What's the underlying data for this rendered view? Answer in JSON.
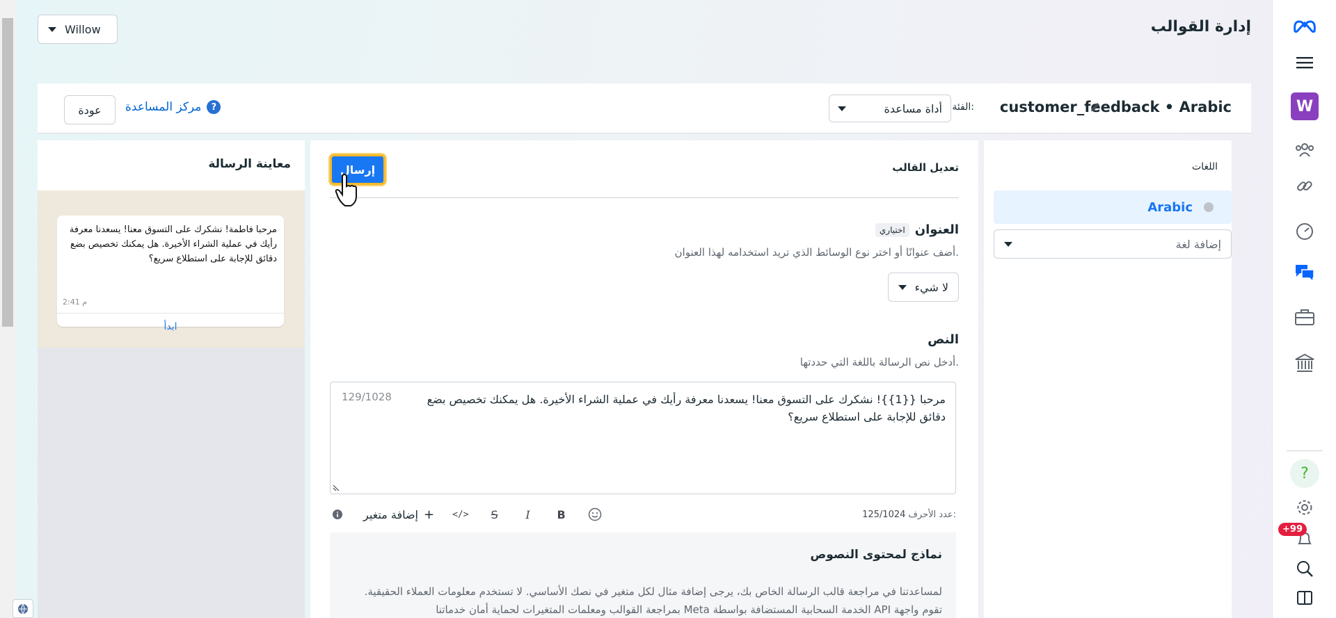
{
  "page_title": "إدارة القوالب",
  "account": {
    "name": "Willow"
  },
  "rail": {
    "workspace_initial": "W",
    "notifications_badge": "+99"
  },
  "header": {
    "template_name": "customer_feedback • Arabic",
    "category_label": "الفئة:",
    "category_value": "أداة مساعدة",
    "help_center": "مركز المساعدة",
    "back": "عودة"
  },
  "languages": {
    "title": "اللغات",
    "items": [
      {
        "label": "Arabic"
      }
    ],
    "add_placeholder": "إضافة لغة"
  },
  "editor": {
    "title": "تعديل القالب",
    "send": "إرسال",
    "header_section": {
      "title": "العنوان",
      "optional": "اختياري",
      "desc": "أضف عنوانًا أو اختر نوع الوسائط الذي تريد استخدامه لهذا العنوان.",
      "media_value": "لا شيء"
    },
    "body_section": {
      "title": "النص",
      "desc": "أدخل نص الرسالة باللغة التي حددتها.",
      "text": "مرحبا {{1}}! نشكرك على التسوق معنا! يسعدنا معرفة رأيك في عملية الشراء الأخيرة. هل يمكنك تخصيص بضع دقائق للإجابة على استطلاع سريع؟",
      "counter": "129/1028"
    },
    "toolbar": {
      "add_variable": "إضافة متغير",
      "char_label": "عدد الأحرف:",
      "char_count": "125/1024"
    },
    "samples": {
      "title": "نماذج لمحتوى النصوص",
      "desc": "لمساعدتنا في مراجعة قالب الرسالة الخاص بك، يرجى إضافة مثال لكل متغير في نصك الأساسي. لا تستخدم معلومات العملاء الحقيقية. تقوم واجهة API الخدمة السحابية المستضافة بواسطة Meta بمراجعة القوالب ومعلمات المتغيرات لحماية أمان خدماتنا"
    }
  },
  "preview": {
    "title": "معاينة الرسالة",
    "message": "مرحبا فاطمة! نشكرك على التسوق معنا! يسعدنا معرفة رأيك في عملية الشراء الأخيرة. هل يمكنك تخصيص بضع دقائق للإجابة على استطلاع سريع؟",
    "time": "2:41 م",
    "cta": "ابدأ"
  },
  "colors": {
    "accent": "#1877f2",
    "highlight": "#f7b928",
    "badge": "#e41e3f"
  }
}
